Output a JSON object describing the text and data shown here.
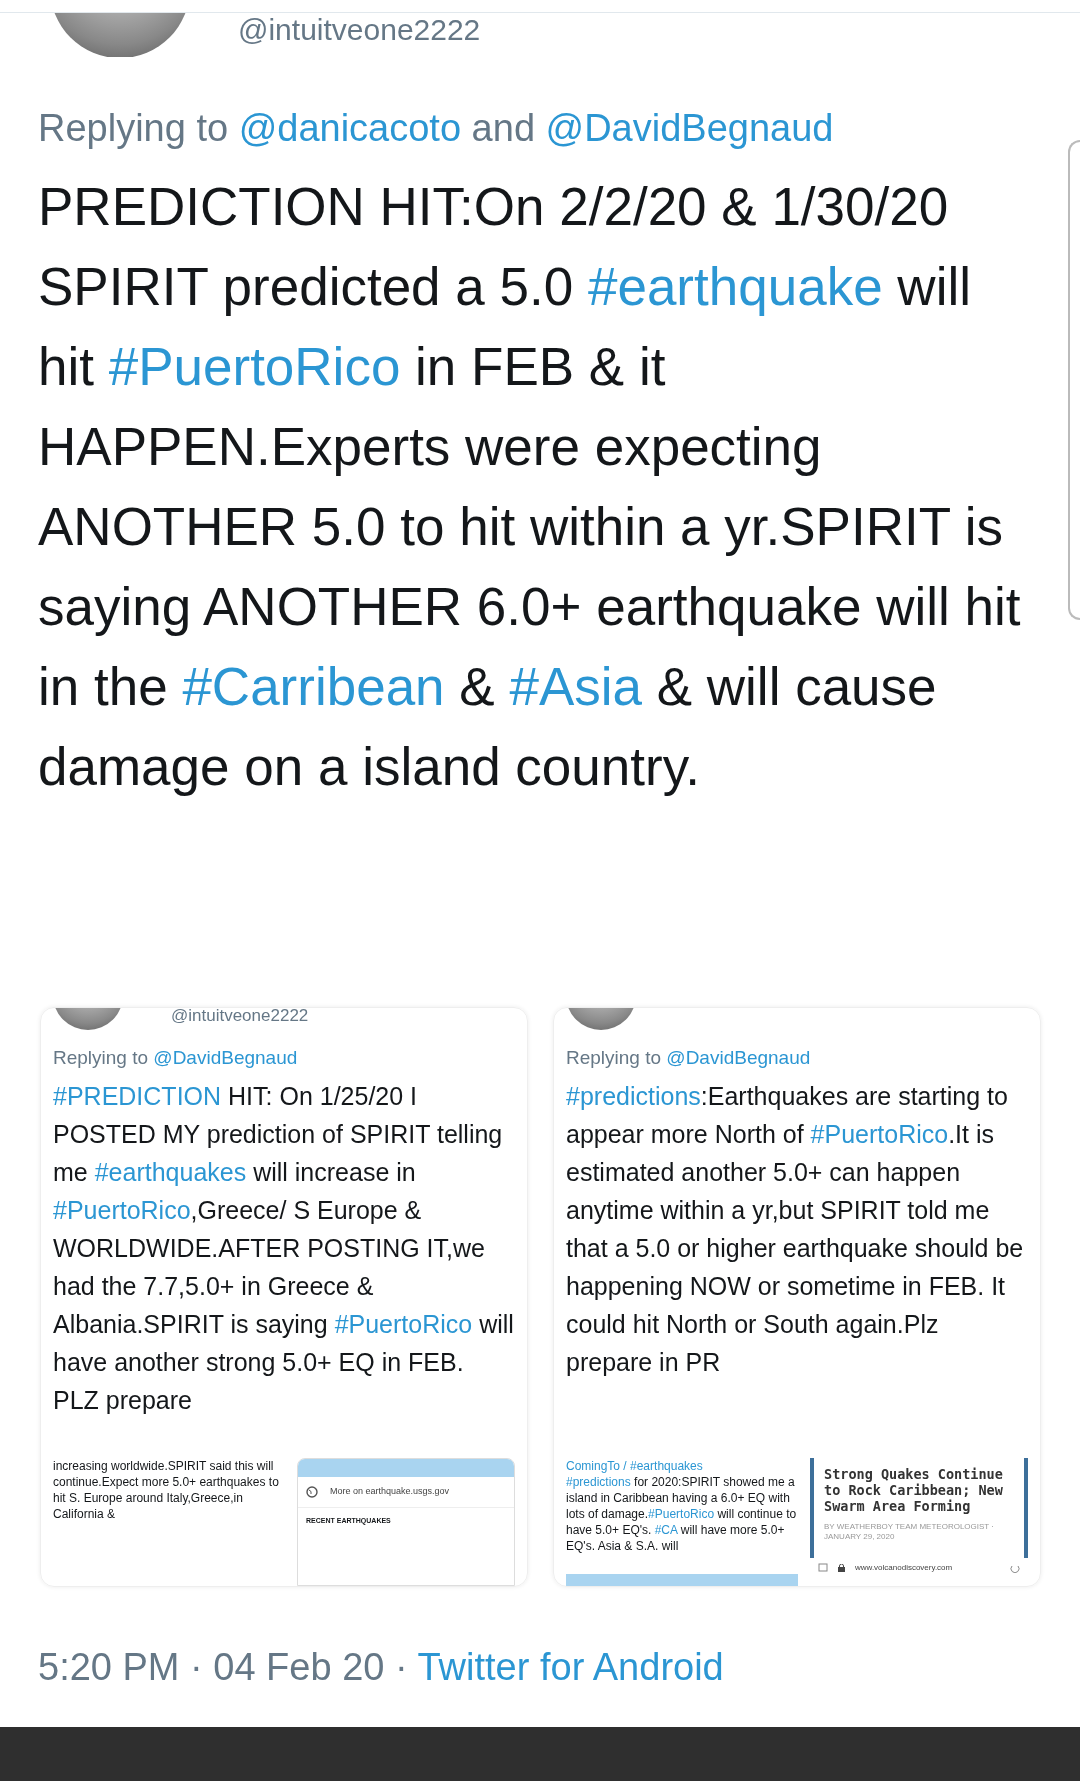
{
  "top_handle": "@intuitveone2222",
  "reply": [
    {
      "kind": "plain",
      "text": "Replying to "
    },
    {
      "kind": "link",
      "text": "@danicacoto"
    },
    {
      "kind": "plain",
      "text": " and "
    },
    {
      "kind": "link",
      "text": "@DavidBegnaud"
    }
  ],
  "tweet_text": [
    {
      "kind": "plain",
      "text": "PREDICTION HIT:On 2/2/20 & 1/30/20 SPIRIT predicted a 5.0 "
    },
    {
      "kind": "link",
      "text": "#earthquake"
    },
    {
      "kind": "plain",
      "text": " will hit "
    },
    {
      "kind": "link",
      "text": "#PuertoRico"
    },
    {
      "kind": "plain",
      "text": " in FEB & it HAPPEN.Experts were expecting ANOTHER 5.0 to hit within a yr.SPIRIT is saying ANOTHER 6.0+ earthquake will hit in the "
    },
    {
      "kind": "link",
      "text": "#Carribean"
    },
    {
      "kind": "plain",
      "text": " & "
    },
    {
      "kind": "link",
      "text": "#Asia"
    },
    {
      "kind": "plain",
      "text": " & will cause damage on a island country."
    }
  ],
  "attached_screenshots": [
    {
      "handle": "@intuitveone2222",
      "reply": [
        {
          "kind": "plain",
          "text": "Replying to "
        },
        {
          "kind": "link",
          "text": "@DavidBegnaud"
        }
      ],
      "body": [
        {
          "kind": "link",
          "text": "#PREDICTION"
        },
        {
          "kind": "plain",
          "text": " HIT: On 1/25/20 I POSTED MY prediction of SPIRIT telling me "
        },
        {
          "kind": "link",
          "text": "#earthquakes"
        },
        {
          "kind": "plain",
          "text": " will increase in "
        },
        {
          "kind": "link",
          "text": "#PuertoRico"
        },
        {
          "kind": "plain",
          "text": ",Greece/ S Europe & WORLDWIDE.AFTER POSTING IT,we had the 7.7,5.0+ in Greece & Albania.SPIRIT is saying "
        },
        {
          "kind": "link",
          "text": "#PuertoRico"
        },
        {
          "kind": "plain",
          "text": " will have another strong 5.0+ EQ in FEB. PLZ prepare"
        }
      ],
      "nested_text": [
        {
          "kind": "plain",
          "text": "increasing worldwide.SPIRIT said this will continue.Expect more 5.0+ earthquakes to hit S. Europe around Italy,Greece,in California &"
        }
      ],
      "card": {
        "kind": "usgs",
        "link": "More on earthquake.usgs.gov",
        "section": "RECENT EARTHQUAKES"
      }
    },
    {
      "reply": [
        {
          "kind": "plain",
          "text": "Replying to "
        },
        {
          "kind": "link",
          "text": "@DavidBegnaud"
        }
      ],
      "body": [
        {
          "kind": "link",
          "text": "#predictions"
        },
        {
          "kind": "plain",
          "text": ":Earthquakes are starting to appear more North of "
        },
        {
          "kind": "link",
          "text": "#PuertoRico"
        },
        {
          "kind": "plain",
          "text": ".It is estimated another 5.0+ can happen anytime within a yr,but SPIRIT told me that a 5.0 or higher earthquake should be happening NOW or sometime in FEB. It could hit North or South again.Plz prepare in PR"
        }
      ],
      "nested_text": [
        {
          "kind": "link",
          "text": "ComingTo / #earthquakes"
        },
        {
          "kind": "break"
        },
        {
          "kind": "link",
          "text": "#predictions"
        },
        {
          "kind": "plain",
          "text": " for 2020:SPIRIT showed me a island in Caribbean having a 6.0+ EQ with lots of damage."
        },
        {
          "kind": "link",
          "text": "#PuertoRico"
        },
        {
          "kind": "plain",
          "text": " will continue to have 5.0+ EQ's. "
        },
        {
          "kind": "link",
          "text": "#CA"
        },
        {
          "kind": "plain",
          "text": " will have more 5.0+ EQ's. Asia & S.A. will"
        }
      ],
      "card": {
        "kind": "article",
        "headline": "Strong Quakes Continue to Rock Caribbean; New Swarm Area Forming",
        "byline": "BY WEATHERBOY TEAM METEOROLOGIST · JANUARY 29, 2020",
        "url": "www.volcanodiscovery.com"
      }
    }
  ],
  "footer": [
    {
      "kind": "plain",
      "text": "5:20 PM · 04 Feb 20 · "
    },
    {
      "kind": "link",
      "text": "Twitter for Android"
    }
  ]
}
